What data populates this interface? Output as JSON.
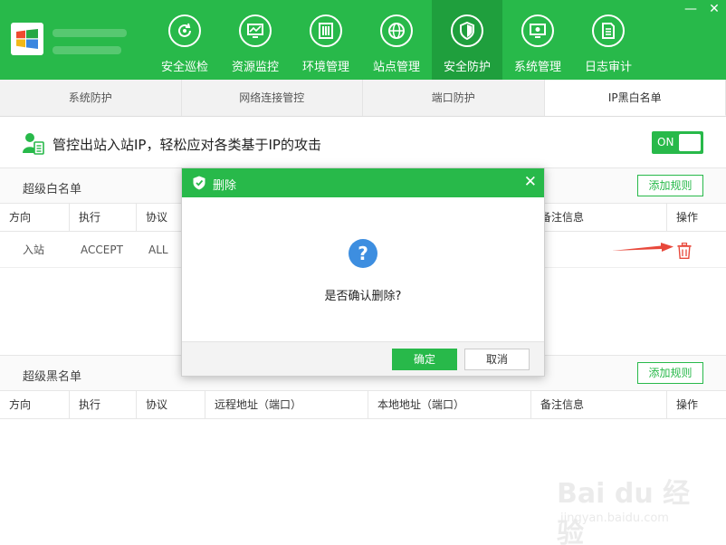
{
  "window": {
    "controls": [
      "—",
      "✕"
    ]
  },
  "nav": [
    {
      "label": "安全巡检",
      "icon": "refresh-icon"
    },
    {
      "label": "资源监控",
      "icon": "monitor-icon"
    },
    {
      "label": "环境管理",
      "icon": "server-icon"
    },
    {
      "label": "站点管理",
      "icon": "globe-icon"
    },
    {
      "label": "安全防护",
      "icon": "shield-icon",
      "active": true
    },
    {
      "label": "系统管理",
      "icon": "settings-monitor-icon"
    },
    {
      "label": "日志审计",
      "icon": "document-icon"
    }
  ],
  "subtabs": [
    "系统防护",
    "网络连接管控",
    "端口防护",
    "IP黑白名单"
  ],
  "info": {
    "text": "管控出站入站IP，轻松应对各类基于IP的攻击",
    "toggle": "ON"
  },
  "whitelist": {
    "title": "超级白名单",
    "add_label": "添加规则",
    "columns": [
      "方向",
      "执行",
      "协议",
      "",
      "",
      "备注信息",
      "操作"
    ],
    "row": {
      "direction": "入站",
      "action": "ACCEPT",
      "protocol": "ALL"
    }
  },
  "blacklist": {
    "title": "超级黑名单",
    "add_label": "添加规则",
    "columns": [
      "方向",
      "执行",
      "协议",
      "远程地址（端口）",
      "本地地址（端口）",
      "备注信息",
      "操作"
    ]
  },
  "dialog": {
    "title": "删除",
    "icon": "question-icon",
    "question_mark": "?",
    "message": "是否确认删除?",
    "ok": "确定",
    "cancel": "取消",
    "close": "✕"
  },
  "watermark": {
    "text": "Bai du 经验",
    "sub": "jingyan.baidu.com"
  },
  "colors": {
    "brand": "#28b94a",
    "brand_dark": "#1f9f3d",
    "question": "#3d8ee0",
    "danger": "#e8483b"
  }
}
